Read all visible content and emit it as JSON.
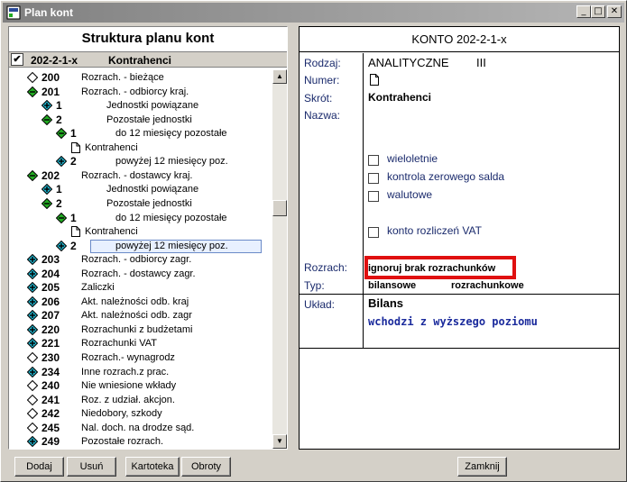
{
  "window": {
    "title": "Plan kont"
  },
  "left": {
    "title": "Struktura planu kont",
    "selected": {
      "code": "202-2-1-x",
      "name": "Kontrahenci"
    },
    "tree": [
      {
        "code": "200",
        "name": "Rozrach. - bieżące",
        "icon": "diamond-empty"
      },
      {
        "code": "201",
        "name": "Rozrach. - odbiorcy kraj.",
        "icon": "diamond-minus"
      },
      {
        "code": "1",
        "name": "Jednostki powiązane",
        "icon": "diamond-plus-cyan"
      },
      {
        "code": "2",
        "name": "Pozostałe jednostki",
        "icon": "diamond-minus"
      },
      {
        "code": "1",
        "name": "do 12 miesięcy pozostałe",
        "icon": "diamond-minus"
      },
      {
        "code": "",
        "name": "Kontrahenci",
        "icon": "document"
      },
      {
        "code": "2",
        "name": "powyżej 12 miesięcy poz.",
        "icon": "diamond-plus-cyan"
      },
      {
        "code": "202",
        "name": "Rozrach. - dostawcy kraj.",
        "icon": "diamond-minus"
      },
      {
        "code": "1",
        "name": "Jednostki powiązane",
        "icon": "diamond-plus-cyan"
      },
      {
        "code": "2",
        "name": "Pozostałe jednostki",
        "icon": "diamond-minus"
      },
      {
        "code": "1",
        "name": "do 12 miesięcy pozostałe",
        "icon": "diamond-minus"
      },
      {
        "code": "",
        "name": "Kontrahenci",
        "icon": "document"
      },
      {
        "code": "2",
        "name": "powyżej 12 miesięcy poz.",
        "icon": "diamond-plus-cyan"
      },
      {
        "code": "203",
        "name": "Rozrach. - odbiorcy zagr.",
        "icon": "diamond-plus-cyan"
      },
      {
        "code": "204",
        "name": "Rozrach. - dostawcy zagr.",
        "icon": "diamond-plus-cyan"
      },
      {
        "code": "205",
        "name": "Zaliczki",
        "icon": "diamond-plus-cyan"
      },
      {
        "code": "206",
        "name": "Akt. należności odb. kraj",
        "icon": "diamond-plus-cyan"
      },
      {
        "code": "207",
        "name": "Akt. należności odb. zagr",
        "icon": "diamond-plus-cyan"
      },
      {
        "code": "220",
        "name": "Rozrachunki z budżetami",
        "icon": "diamond-plus-cyan"
      },
      {
        "code": "221",
        "name": "Rozrachunki VAT",
        "icon": "diamond-plus-cyan"
      },
      {
        "code": "230",
        "name": "Rozrach.- wynagrodz",
        "icon": "diamond-empty"
      },
      {
        "code": "234",
        "name": "Inne rozrach.z prac.",
        "icon": "diamond-plus-cyan"
      },
      {
        "code": "240",
        "name": "Nie wniesione wkłady",
        "icon": "diamond-empty"
      },
      {
        "code": "241",
        "name": "Roz. z udział. akcjon.",
        "icon": "diamond-empty"
      },
      {
        "code": "242",
        "name": "Niedobory, szkody",
        "icon": "diamond-empty"
      },
      {
        "code": "245",
        "name": "Nal. doch. na drodze sąd.",
        "icon": "diamond-empty"
      },
      {
        "code": "249",
        "name": "Pozostałe rozrach.",
        "icon": "diamond-plus-cyan"
      }
    ]
  },
  "konto": {
    "header": "KONTO  202-2-1-x",
    "labels": {
      "rodzaj": "Rodzaj:",
      "numer": "Numer:",
      "skrot": "Skrót:",
      "nazwa": "Nazwa:",
      "rozrach": "Rozrach:",
      "typ": "Typ:",
      "uklad": "Układ:"
    },
    "rodzaj_value": "ANALITYCZNE",
    "rodzaj_level": "III",
    "skrot_value": "Kontrahenci",
    "checkboxes": {
      "wieloletnie": "wieloletnie",
      "kontrola": "kontrola zerowego salda",
      "walutowe": "walutowe",
      "vat": "konto rozliczeń VAT"
    },
    "rozrach_value": "ignoruj brak rozrachunków",
    "typ_bilansowe": "bilansowe",
    "typ_rozrachunkowe": "rozrachunkowe",
    "uklad_value": "Bilans",
    "uklad_sub": "wchodzi z wyższego poziomu"
  },
  "buttons": {
    "dodaj": "Dodaj",
    "usun": "Usuń",
    "kartoteka": "Kartoteka",
    "obroty": "Obroty",
    "zamknij": "Zamknij"
  },
  "colors": {
    "highlight": "#e01010",
    "label_blue": "#1a2a6c",
    "green_node": "#22aa22",
    "cyan_node": "#1fb0c8"
  }
}
